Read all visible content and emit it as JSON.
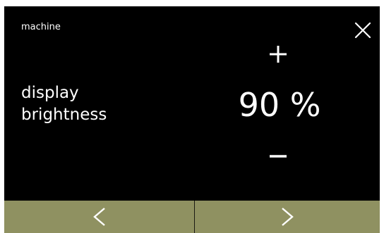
{
  "header": {
    "section_label": "machine",
    "close_icon": "close-icon"
  },
  "setting": {
    "label_line1": "display",
    "label_line2": "brightness",
    "value": "90 %",
    "increase_icon": "plus-icon",
    "decrease_icon": "minus-icon"
  },
  "navigation": {
    "prev_icon": "chevron-left-icon",
    "next_icon": "chevron-right-icon"
  },
  "colors": {
    "screen_background": "#000000",
    "text": "#ffffff",
    "nav_bar": "#8f9161"
  }
}
